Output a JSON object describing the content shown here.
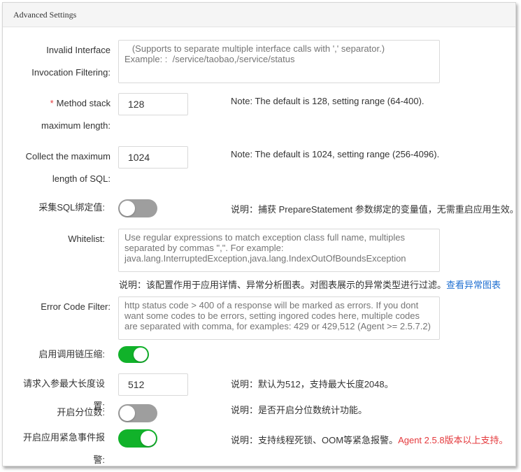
{
  "panel": {
    "title": "Advanced Settings"
  },
  "invalid_interface": {
    "label_line1": "Invalid Interface",
    "label_line2": "Invocation Filtering:",
    "placeholder": "   (Supports to separate multiple interface calls with ',' separator.)\nExample: :  /service/taobao,/service/status"
  },
  "method_stack": {
    "required_mark": "*",
    "label_line1": "Method stack",
    "label_line2": "maximum length:",
    "value": "128",
    "note": "Note: The default is 128, setting range (64-400)."
  },
  "sql_length": {
    "label_line1": "Collect the maximum",
    "label_line2": "length of SQL:",
    "value": "1024",
    "note": "Note: The default is 1024, setting range (256-4096)."
  },
  "sql_binding": {
    "label": "采集SQL绑定值:",
    "enabled": false,
    "note": "说明：捕获 PrepareStatement 参数绑定的变量值，无需重启应用生效。"
  },
  "whitelist": {
    "label": "Whitelist:",
    "placeholder": "Use regular expressions to match exception class full name, multiples separated by commas \",\". For example: java.lang.InterruptedException,java.lang.IndexOutOfBoundsException",
    "note": "说明：该配置作用于应用详情、异常分析图表。对图表展示的异常类型进行过滤。",
    "link": "查看异常图表"
  },
  "error_code": {
    "label": "Error Code Filter:",
    "placeholder": "http status code > 400 of a response will be marked as errors. If you dont want some codes to be errors, setting ingored codes here, multiple codes are separated with comma, for examples: 429 or 429,512 (Agent >= 2.5.7.2)"
  },
  "trace_compress": {
    "label": "启用调用链压缩:",
    "enabled": true
  },
  "request_param": {
    "label": "请求入参最大长度设置:",
    "value": "512",
    "note": "说明：默认为512，支持最大长度2048。"
  },
  "quantile": {
    "label": "开启分位数:",
    "enabled": false,
    "note": "说明：是否开启分位数统计功能。"
  },
  "emergency_alert": {
    "label": "开启应用紧急事件报警:",
    "enabled": true,
    "note": "说明：支持线程死锁、OOM等紧急报警。",
    "note_highlight": "Agent 2.5.8版本以上支持。"
  }
}
